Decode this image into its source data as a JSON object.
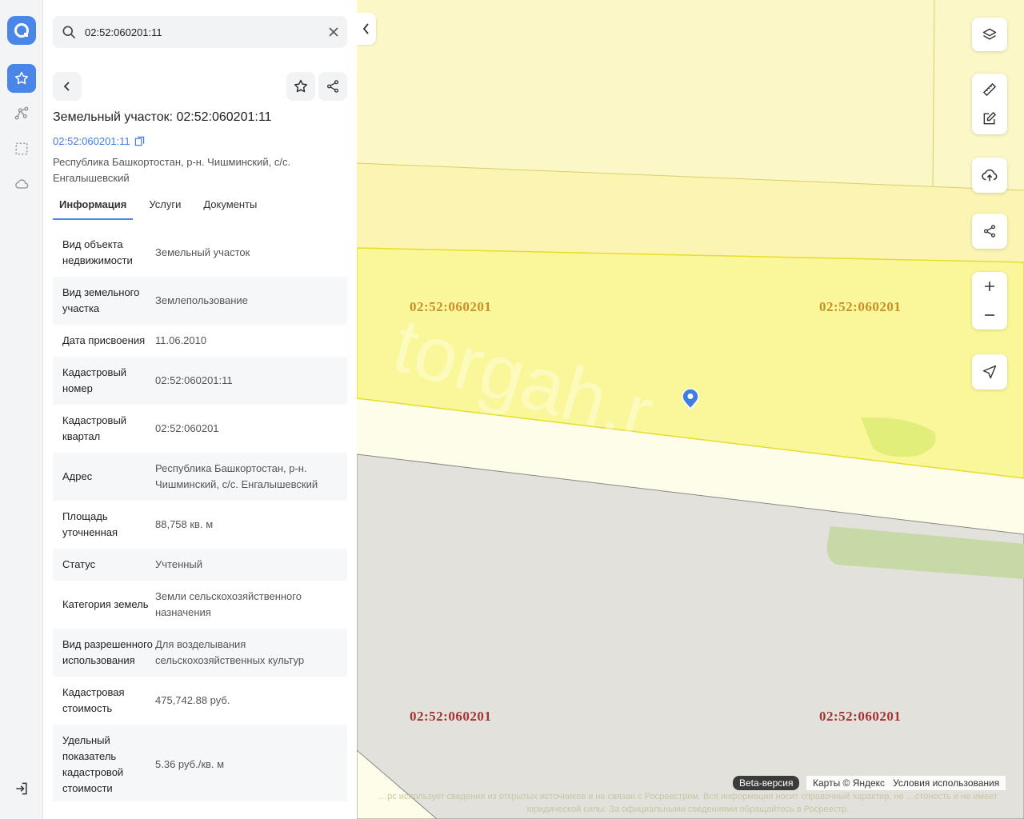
{
  "search": {
    "value": "02:52:060201:11",
    "placeholder": ""
  },
  "object": {
    "title": "Земельный участок: 02:52:060201:11",
    "cad_number": "02:52:060201:11",
    "address": "Республика Башкортостан, р-н. Чишминский, с/с. Енгалышевский"
  },
  "tabs": [
    {
      "label": "Информация",
      "active": true
    },
    {
      "label": "Услуги",
      "active": false
    },
    {
      "label": "Документы",
      "active": false
    }
  ],
  "info": [
    {
      "key": "Вид объекта недвижимости",
      "value": "Земельный участок"
    },
    {
      "key": "Вид земельного участка",
      "value": "Землепользование"
    },
    {
      "key": "Дата присвоения",
      "value": "11.06.2010"
    },
    {
      "key": "Кадастровый номер",
      "value": "02:52:060201:11"
    },
    {
      "key": "Кадастровый квартал",
      "value": "02:52:060201"
    },
    {
      "key": "Адрес",
      "value": "Республика Башкортостан, р-н. Чишминский, с/с. Енгалышевский"
    },
    {
      "key": "Площадь уточненная",
      "value": "88,758 кв. м"
    },
    {
      "key": "Статус",
      "value": "Учтенный"
    },
    {
      "key": "Категория земель",
      "value": "Земли сельскохозяйственного назначения"
    },
    {
      "key": "Вид разрешенного использования",
      "value": "Для возделывания сельскохозяйственных культур"
    },
    {
      "key": "Кадастровая стоимость",
      "value": "475,742.88 руб."
    },
    {
      "key": "Удельный показатель кадастровой стоимости",
      "value": "5.36 руб./кв. м"
    }
  ],
  "map": {
    "labels": [
      {
        "text": "02:52:060201",
        "color": "#c8902a"
      },
      {
        "text": "02:52:060201",
        "color": "#c8902a"
      },
      {
        "text": "02:52:060201",
        "color": "#a83232"
      },
      {
        "text": "02:52:060201",
        "color": "#a83232"
      }
    ],
    "watermark": "torgah.r",
    "beta": "Beta-версия",
    "attribution": "Карты © Яндекс",
    "terms": "Условия использования",
    "disclaimer": "…рс использует сведения из открытых источников и не связан с Росреестром. Вся информация носит справочный характер, не …стоность и не имеет юридической силы. За официальными сведениями обращайтесь в Росреестр."
  },
  "colors": {
    "accent": "#4a86e8",
    "parcel_fill": "#faf79a",
    "parcel_border": "#e6dd2a",
    "pin": "#3f7de0"
  }
}
